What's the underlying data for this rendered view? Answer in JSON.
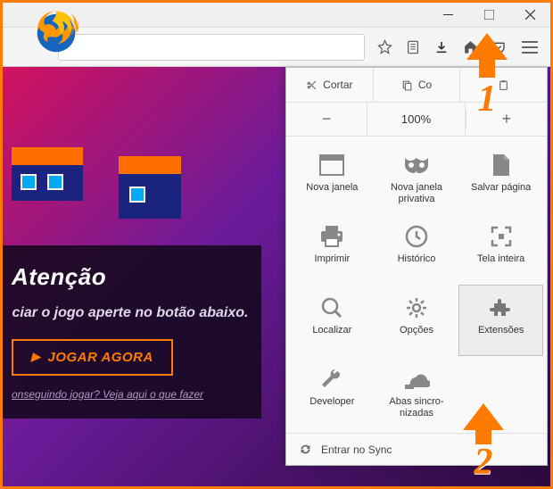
{
  "window": {
    "minimize": "—",
    "maximize": "▢",
    "close": "✕"
  },
  "menu": {
    "edit": {
      "cut": "Cortar",
      "copy": "Co",
      "paste": ""
    },
    "zoom": {
      "minus": "−",
      "value": "100%",
      "plus": "+"
    },
    "items": [
      {
        "label": "Nova janela",
        "icon": "new-window"
      },
      {
        "label": "Nova janela privativa",
        "icon": "private-window"
      },
      {
        "label": "Salvar página",
        "icon": "save-page"
      },
      {
        "label": "Imprimir",
        "icon": "print"
      },
      {
        "label": "Histórico",
        "icon": "history"
      },
      {
        "label": "Tela inteira",
        "icon": "fullscreen"
      },
      {
        "label": "Localizar",
        "icon": "find"
      },
      {
        "label": "Opções",
        "icon": "options"
      },
      {
        "label": "Extensões",
        "icon": "addons"
      },
      {
        "label": "Developer",
        "icon": "developer"
      },
      {
        "label": "Abas sincro-nizadas",
        "icon": "synced-tabs"
      }
    ],
    "sync": "Entrar no Sync"
  },
  "page": {
    "heading": "Atenção",
    "text": "ciar o jogo aperte no botão abaixo.",
    "play": "JOGAR AGORA",
    "help": "onseguindo jogar? Veja aqui o que fazer"
  },
  "annotations": {
    "one": "1",
    "two": "2"
  },
  "colors": {
    "accent": "#ff7a00"
  }
}
